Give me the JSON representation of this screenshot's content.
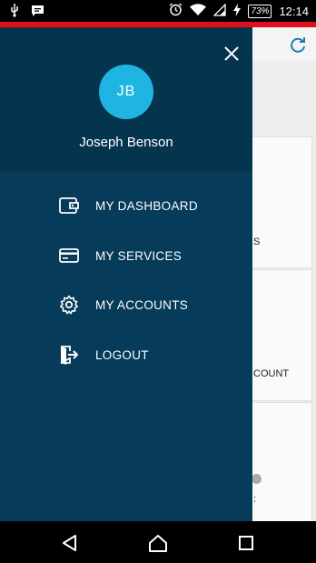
{
  "status_bar": {
    "battery": "73%",
    "time": "12:14"
  },
  "background": {
    "card1_text": "S",
    "card2_text": "COUNT",
    "card3_text": ":"
  },
  "drawer": {
    "avatar_initials": "JB",
    "user_name": "Joseph Benson",
    "menu": [
      {
        "label": "MY DASHBOARD",
        "icon": "wallet-icon"
      },
      {
        "label": "MY SERVICES",
        "icon": "credit-card-icon"
      },
      {
        "label": "MY ACCOUNTS",
        "icon": "gear-icon"
      },
      {
        "label": "LOGOUT",
        "icon": "logout-icon"
      }
    ]
  },
  "colors": {
    "drawer_bg": "#063b59",
    "header_bg": "#05344f",
    "avatar_bg": "#1fb5e3",
    "accent_red": "#e3101a"
  }
}
